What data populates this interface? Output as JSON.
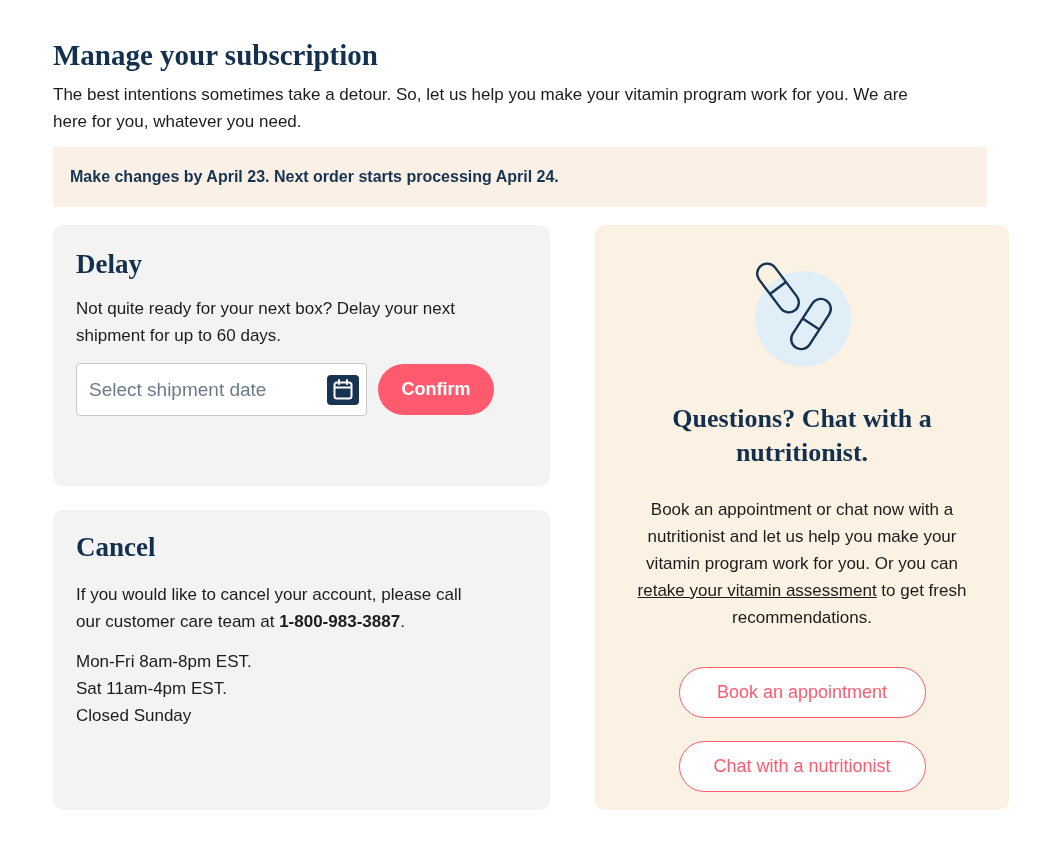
{
  "page": {
    "title": "Manage your subscription",
    "intro": "The best intentions sometimes take a detour. So, let us help you make your vitamin program work for you. We are here for you, whatever you need."
  },
  "notice": "Make changes by April 23. Next order starts processing April 24.",
  "delay_card": {
    "title": "Delay",
    "text": "Not quite ready for your next box? Delay your next shipment for up to 60 days.",
    "date_field": {
      "placeholder": "Select shipment date"
    },
    "confirm_button": "Confirm"
  },
  "cancel_card": {
    "title": "Cancel",
    "text": "If you would like to cancel your account, please call our customer care team at **1-800-983-3887**.",
    "hours": [
      "Mon-Fri 8am-8pm EST.",
      "Sat 11am-4pm EST.",
      "Closed Sunday"
    ]
  },
  "chat_card": {
    "title": "Questions? Chat with a nutritionist.",
    "text": "Book an appointment or chat now with a nutritionist and let us help you make your vitamin program work for you. Or you can",
    "link": "retake your vitamin assessment",
    "text_after": "to get fresh recommendations.",
    "buttons": [
      "Book an appointment",
      "Chat with a nutritionist"
    ]
  }
}
